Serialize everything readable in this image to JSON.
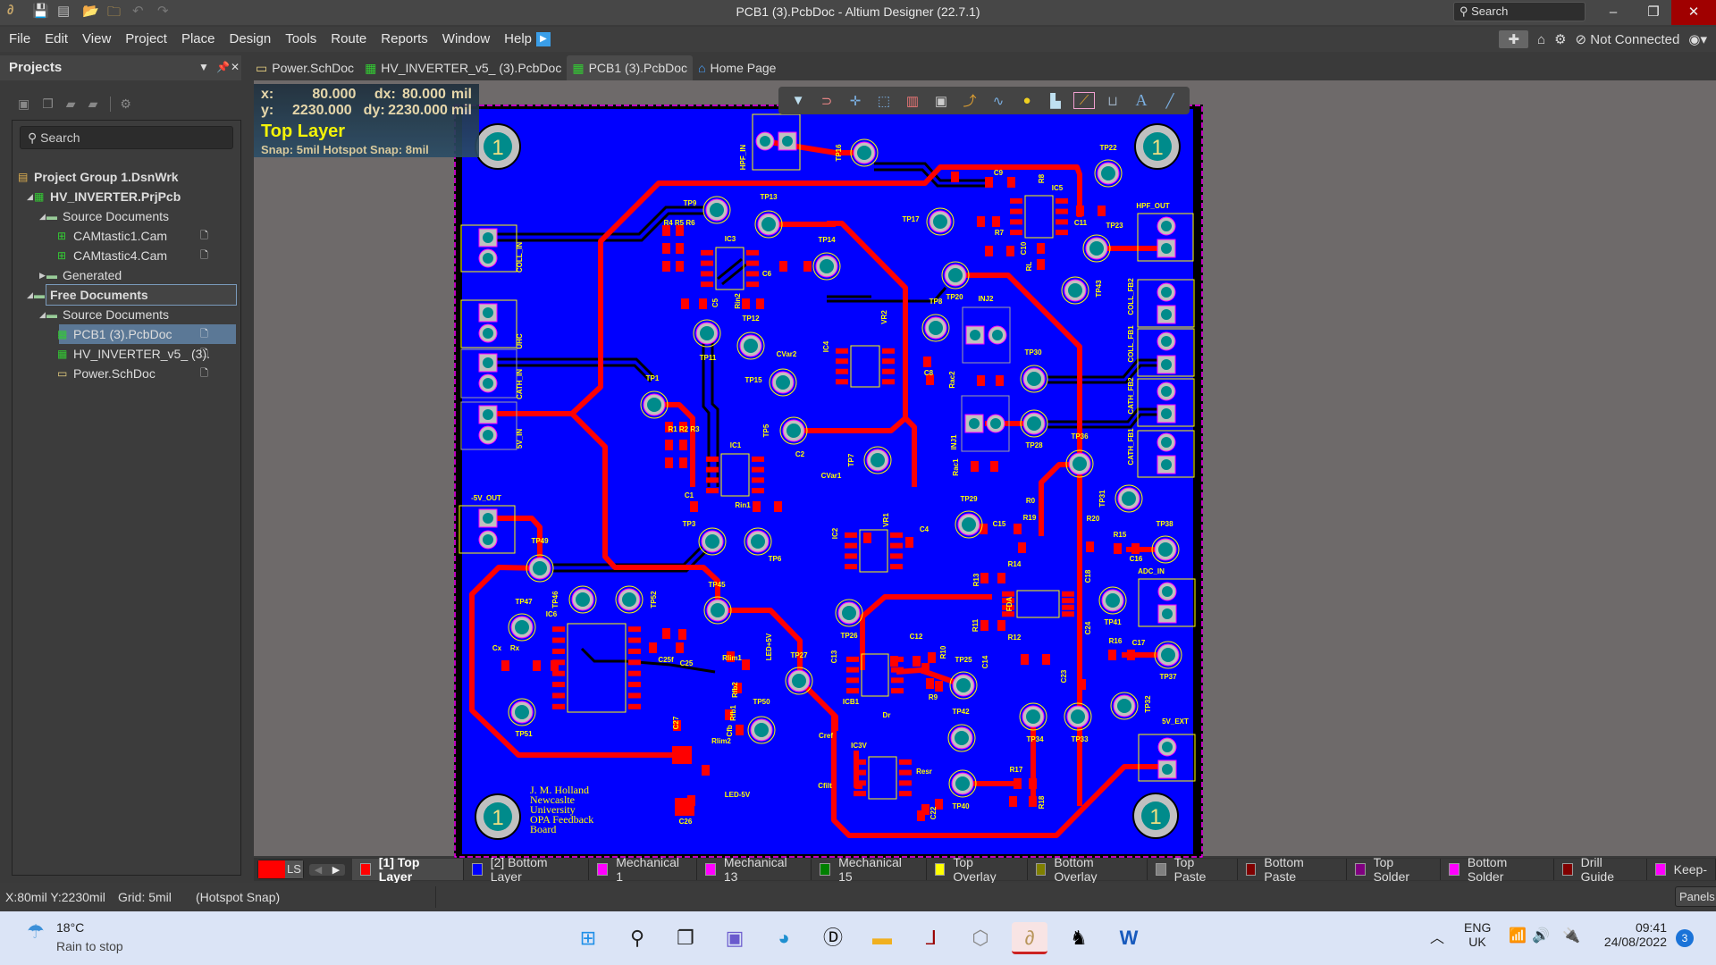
{
  "window": {
    "title": "PCB1 (3).PcbDoc - Altium Designer (22.7.1)",
    "search_placeholder": "Search",
    "quick_access_icons": [
      "app-logo-icon",
      "save-icon",
      "save-all-icon",
      "open-icon",
      "open-project-icon",
      "undo-icon",
      "redo-icon"
    ]
  },
  "menu": {
    "items": [
      "File",
      "Edit",
      "View",
      "Project",
      "Place",
      "Design",
      "Tools",
      "Route",
      "Reports",
      "Window",
      "Help"
    ],
    "connection_status": "Not Connected"
  },
  "projects_panel": {
    "title": "Projects",
    "search_placeholder": "Search",
    "tree": [
      {
        "label": "Project Group 1.DsnWrk",
        "icon": "workspace-icon",
        "level": 0,
        "bold": true
      },
      {
        "label": "HV_INVERTER.PrjPcb",
        "icon": "pcb-project-icon",
        "level": 1,
        "bold": true,
        "expanded": true
      },
      {
        "label": "Source Documents",
        "icon": "folder-icon",
        "level": 2,
        "expanded": true
      },
      {
        "label": "CAMtastic1.Cam",
        "icon": "cam-icon",
        "level": 3
      },
      {
        "label": "CAMtastic4.Cam",
        "icon": "cam-icon",
        "level": 3
      },
      {
        "label": "Generated",
        "icon": "folder-icon",
        "level": 2,
        "expanded": false
      },
      {
        "label": "Free Documents",
        "icon": "folder-icon",
        "level": 1,
        "bold": true,
        "expanded": true,
        "focused": true
      },
      {
        "label": "Source Documents",
        "icon": "folder-icon",
        "level": 2,
        "expanded": true
      },
      {
        "label": "PCB1 (3).PcbDoc",
        "icon": "pcb-doc-icon",
        "level": 3,
        "selected": true
      },
      {
        "label": "HV_INVERTER_v5_ (3).",
        "icon": "pcb-doc-icon",
        "level": 3
      },
      {
        "label": "Power.SchDoc",
        "icon": "sch-doc-icon",
        "level": 3
      }
    ]
  },
  "doc_tabs": [
    {
      "label": "Power.SchDoc",
      "icon": "sch-doc-icon"
    },
    {
      "label": "HV_INVERTER_v5_ (3).PcbDoc",
      "icon": "pcb-doc-icon"
    },
    {
      "label": "PCB1 (3).PcbDoc",
      "icon": "pcb-doc-icon",
      "active": true
    },
    {
      "label": "Home Page",
      "icon": "home-icon"
    }
  ],
  "hud": {
    "x_label": "x:",
    "x": "80.000",
    "dx_label": "dx:",
    "dx": "80.000",
    "unit": "mil",
    "y_label": "y:",
    "y": "2230.000",
    "dy_label": "dy:",
    "dy": "2230.000",
    "layer": "Top Layer",
    "snap": "Snap: 5mil Hotspot Snap: 8mil"
  },
  "active_bar_icons": [
    "filter-icon",
    "interactive-routing-magnet-icon",
    "crosshair-icon",
    "select-rect-icon",
    "align-icon",
    "component-icon",
    "route-icon",
    "length-tune-icon",
    "via-icon",
    "polygon-icon",
    "keepout-icon",
    "dimension-icon",
    "text-icon",
    "line-icon"
  ],
  "pcb": {
    "colors": {
      "board": "#0000ff",
      "top_layer": "#ff0000",
      "overlay": "#ffff00",
      "pad": "#008b8b",
      "pad_ring": "#c0c0c0"
    },
    "mounting_hole_label": "1",
    "designators": [
      "TP9",
      "TP13",
      "R4 R5 R6",
      "IC3",
      "C6",
      "C5",
      "Rin2",
      "TP12",
      "TP11",
      "CVar2",
      "TP15",
      "TP1",
      "TP5",
      "R1 R2 R3",
      "IC1",
      "C2",
      "COLL_IN",
      "UHC",
      "CATH_IN",
      "5V_IN",
      "HPF_IN",
      "TP14",
      "IC4",
      "TP16",
      "TP22",
      "C9",
      "R8",
      "IC5",
      "TP17",
      "C11",
      "TP23",
      "R7",
      "C10",
      "RL",
      "HPF_OUT",
      "TP43",
      "TP20",
      "TP8",
      "INJ2",
      "VR2",
      "C8",
      "Rac2",
      "TP30",
      "TP28",
      "TP36",
      "INJ1",
      "Rac1",
      "TP7",
      "COLL_FB2",
      "COLL_FB1",
      "CATH_FB2",
      "CATH_FB1",
      "-5V_OUT",
      "TP49",
      "C1",
      "Rin1",
      "TP3",
      "TP6",
      "TP45",
      "TP46",
      "TP52",
      "TP47",
      "IC6",
      "Cx",
      "Rx",
      "C25f",
      "C25",
      "Rlim1",
      "LED+5V",
      "TP27",
      "C13",
      "Rfb2",
      "Rfb1",
      "TP50",
      "C27",
      "Cfb",
      "Rlim2",
      "TP51",
      "Cref",
      "LED-5V",
      "Cfilt",
      "C26",
      "TP29",
      "R0",
      "TP31",
      "R19",
      "R20",
      "C15",
      "C4",
      "IC2",
      "VR1",
      "TP38",
      "R15",
      "C16",
      "R14",
      "R13",
      "C18",
      "ADC_IN",
      "FDA",
      "TP41",
      "R11",
      "C24",
      "R12",
      "TP26",
      "C12",
      "R10",
      "R16",
      "C17",
      "C14",
      "TP25",
      "C23",
      "TP37",
      "R9",
      "ICB1",
      "TP32",
      "TP42",
      "Dr",
      "TP34",
      "TP33",
      "5V_EXT",
      "IC3V",
      "Resr",
      "R17",
      "TP40",
      "R18",
      "C22",
      "CVar1"
    ],
    "silkscreen_text": [
      "J. M. Holland",
      "Newcaslte",
      "University",
      "OPA Feedback",
      "Board"
    ]
  },
  "layer_tabs": [
    {
      "label": "[1] Top Layer",
      "color": "#ff0000",
      "active": true
    },
    {
      "label": "[2] Bottom Layer",
      "color": "#0000ff"
    },
    {
      "label": "Mechanical 1",
      "color": "#ff00ff"
    },
    {
      "label": "Mechanical 13",
      "color": "#ff00ff"
    },
    {
      "label": "Mechanical 15",
      "color": "#008000"
    },
    {
      "label": "Top Overlay",
      "color": "#ffff00"
    },
    {
      "label": "Bottom Overlay",
      "color": "#808000"
    },
    {
      "label": "Top Paste",
      "color": "#808080"
    },
    {
      "label": "Bottom Paste",
      "color": "#800000"
    },
    {
      "label": "Top Solder",
      "color": "#800080"
    },
    {
      "label": "Bottom Solder",
      "color": "#ff00ff"
    },
    {
      "label": "Drill Guide",
      "color": "#800000"
    },
    {
      "label": "Keep-",
      "color": "#ff00ff"
    }
  ],
  "layer_set": {
    "label": "LS",
    "current_color": "#ff0000"
  },
  "status": {
    "coords": "X:80mil Y:2230mil",
    "grid": "Grid: 5mil",
    "snap": "(Hotspot Snap)",
    "panels_button": "Panels"
  },
  "taskbar": {
    "weather_temp": "18°C",
    "weather_desc": "Rain to stop",
    "apps": [
      "start-icon",
      "search-icon",
      "task-view-icon",
      "teams-chat-icon",
      "edge-icon",
      "dell-icon",
      "file-explorer-icon",
      "ltspice-icon",
      "3d-box-icon",
      "altium-icon",
      "ti-icon",
      "word-icon"
    ],
    "lang": "ENG",
    "region": "UK",
    "time": "09:41",
    "date": "24/08/2022",
    "notifications": "3"
  }
}
